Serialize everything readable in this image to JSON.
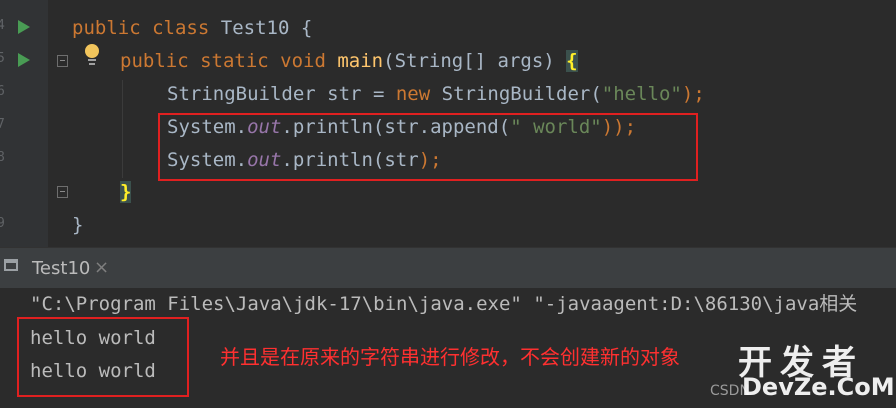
{
  "editor": {
    "line_numbers": [
      "4",
      "5",
      "6",
      "7",
      "8",
      "9"
    ],
    "lines": {
      "class_decl": {
        "public": "public",
        "class": "class",
        "name": "Test10",
        "brace": "{"
      },
      "main_decl": {
        "mods": "public static void",
        "name": "main",
        "params": "(String[] args)",
        "brace": "{"
      },
      "sb_line": {
        "type": "StringBuilder",
        "var": "str",
        "eq": "=",
        "new": "new",
        "ctor": "StringBuilder(",
        "arg": "\"hello\"",
        "end": ");"
      },
      "print1": {
        "prefix": "System.",
        "field": "out",
        "call": ".println(str.append(",
        "arg": "\" world\"",
        "end": "));"
      },
      "print2": {
        "prefix": "System.",
        "field": "out",
        "call": ".println(str",
        "end": ");"
      },
      "close_inner": "}",
      "close_outer": "}"
    }
  },
  "run_panel": {
    "tab_label": "Test10",
    "close_glyph": "×",
    "command": "\"C:\\Program Files\\Java\\jdk-17\\bin\\java.exe\" \"-javaagent:D:\\86130\\java相关",
    "output": [
      "hello world",
      "hello world"
    ],
    "annotation": "并且是在原来的字符串进行修改，不会创建新的对象",
    "watermark_main": "开发者",
    "watermark_sub": "DevZe.CoM",
    "watermark_csdn": "CSDN"
  },
  "colors": {
    "keyword": "#cc7832",
    "method": "#ffc66d",
    "string": "#6a8759",
    "field": "#9876aa",
    "text": "#a9b7c6",
    "highlight_border": "#e02020"
  },
  "icons": [
    "run-icon",
    "fold-icon",
    "intention-bulb-icon",
    "console-icon",
    "close-icon"
  ]
}
